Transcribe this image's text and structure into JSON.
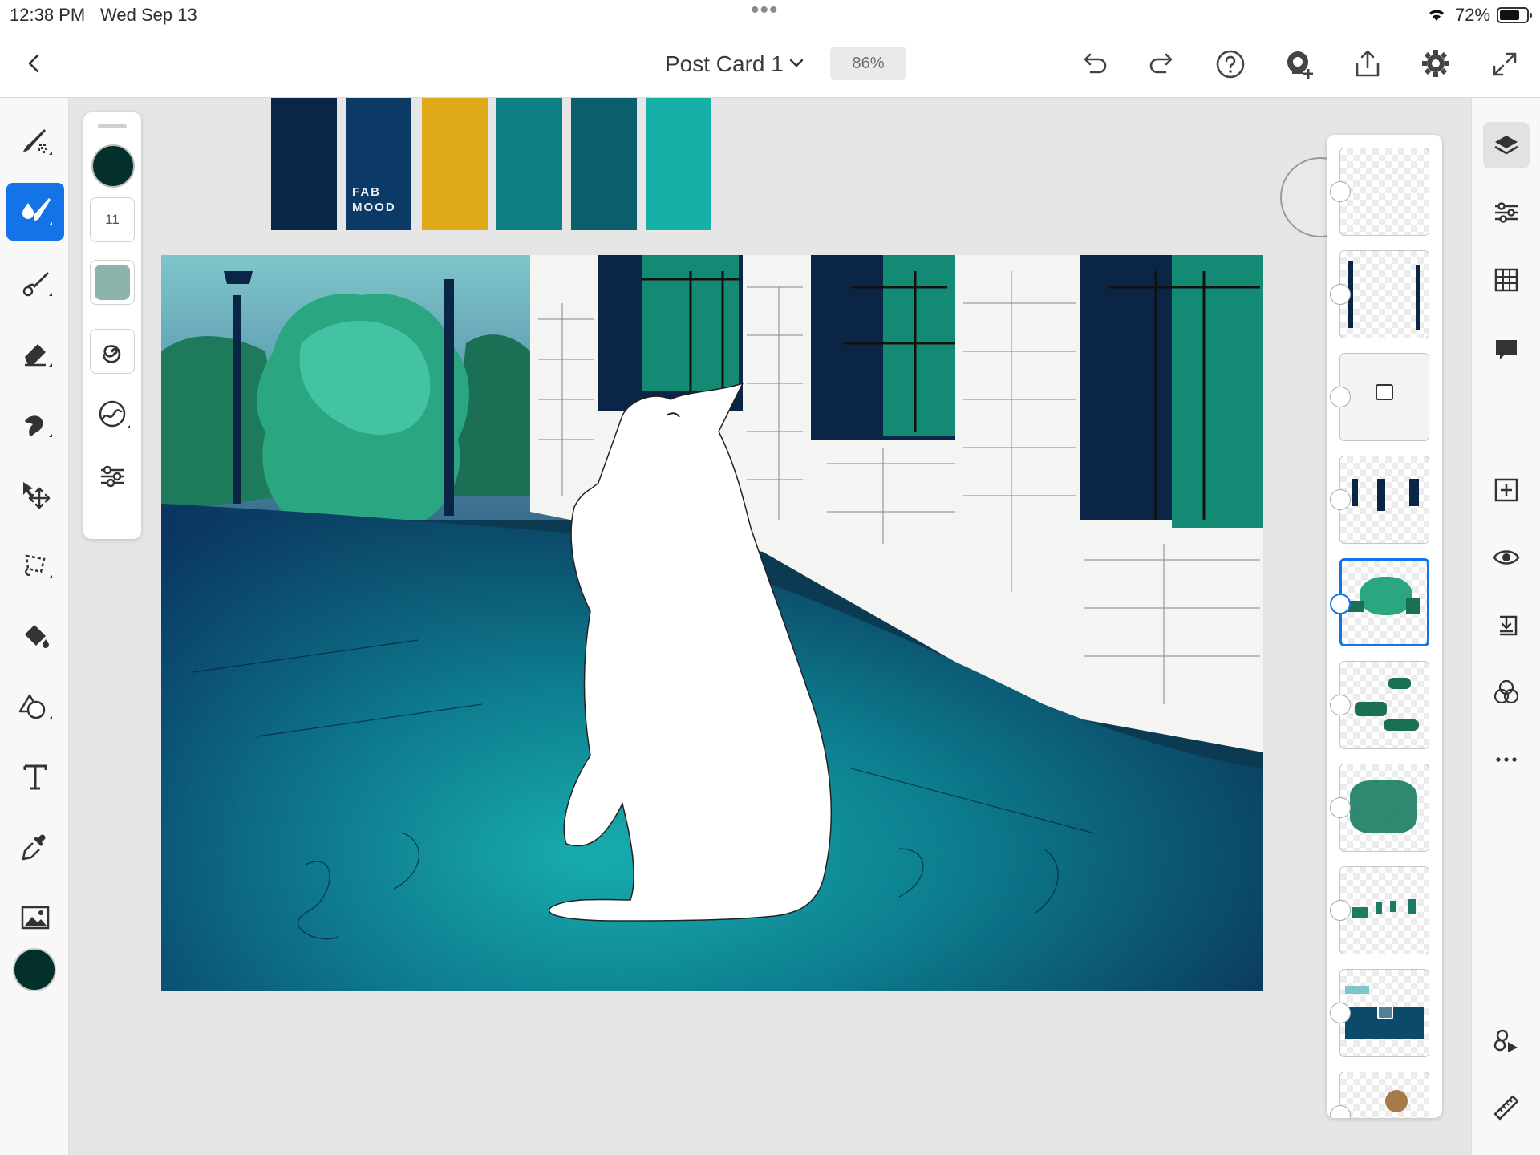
{
  "status_bar": {
    "time": "12:38 PM",
    "date": "Wed Sep 13",
    "battery": "72%",
    "multitask_dots": "•••"
  },
  "header": {
    "document_title": "Post Card 1",
    "zoom": "86%"
  },
  "top_icons": [
    "back-chevron-icon",
    "title-dropdown-icon",
    "undo-icon",
    "redo-icon",
    "help-icon",
    "invite-icon",
    "share-icon",
    "settings-icon",
    "fullscreen-icon"
  ],
  "left_tools": [
    "pixel-brush-icon",
    "live-brush-icon",
    "vector-brush-icon",
    "eraser-icon",
    "smudge-icon",
    "transform-icon",
    "lasso-icon",
    "fill-icon",
    "shape-icon",
    "text-icon",
    "eyedropper-icon",
    "image-icon"
  ],
  "active_tool": "live-brush-icon",
  "colors": {
    "current": "#03302a",
    "accent": "#1473e6"
  },
  "brush_panel": {
    "size": "11",
    "icons": [
      "opacity-swatch-icon",
      "flow-icon",
      "blend-icon",
      "brush-settings-icon"
    ]
  },
  "palette": {
    "label": "FAB MOOD",
    "swatches": [
      "#0b2547",
      "#0c3a66",
      "#e0a91a",
      "#0f7f85",
      "#0c5e6d",
      "#15b0a8"
    ]
  },
  "layers": {
    "count": 10,
    "selected_index": 4
  },
  "right_rail": [
    "layers-icon",
    "layer-properties-icon",
    "grid-icon",
    "comment-icon",
    "add-layer-icon",
    "visibility-icon",
    "merge-layer-icon",
    "blend-modes-icon",
    "more-icon",
    "liquify-icon",
    "ruler-icon"
  ]
}
